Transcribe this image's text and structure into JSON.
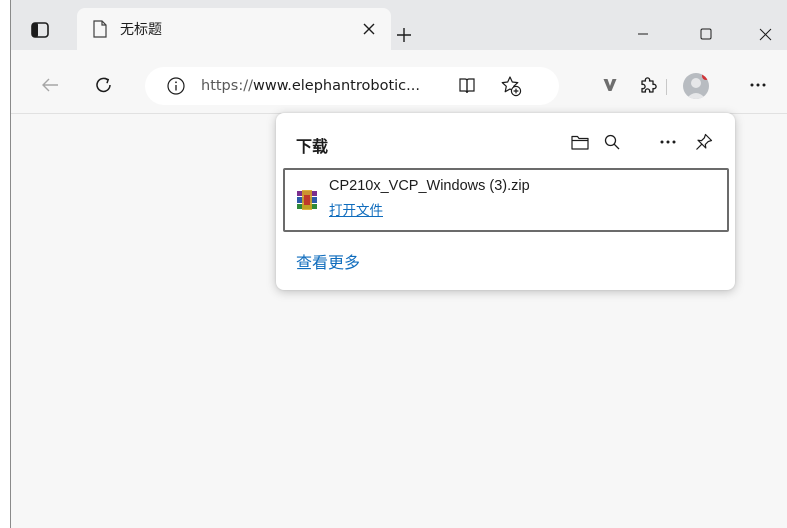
{
  "tab": {
    "title": "无标题"
  },
  "toolbar": {
    "url_protocol": "https://",
    "url_rest": "www.elephantrobotic..."
  },
  "downloads": {
    "title": "下载",
    "items": [
      {
        "file_name": "CP210x_VCP_Windows (3).zip",
        "action_label": "打开文件"
      }
    ],
    "see_more": "查看更多"
  },
  "window_controls": {
    "minimize": "—",
    "maximize": "☐",
    "close": "✕"
  },
  "icons": {
    "tab_actions": "tab-actions-icon",
    "page": "page-icon",
    "tab_close": "close-icon",
    "new_tab": "plus-icon",
    "back": "back-arrow-icon",
    "refresh": "refresh-icon",
    "site_info": "info-icon",
    "reader": "immersive-reader-icon",
    "favorite": "add-favorite-icon",
    "extension_v": "extension-v-icon",
    "extensions": "puzzle-icon",
    "more": "more-icon",
    "folder": "folder-icon",
    "search": "search-icon",
    "panel_more": "more-icon",
    "pin": "pin-icon",
    "archive": "archive-icon"
  },
  "colors": {
    "link": "#0f6cbd",
    "titlebar": "#e7e8ea",
    "toolbar": "#f7f7f7",
    "avatar_badge": "#d13438"
  }
}
